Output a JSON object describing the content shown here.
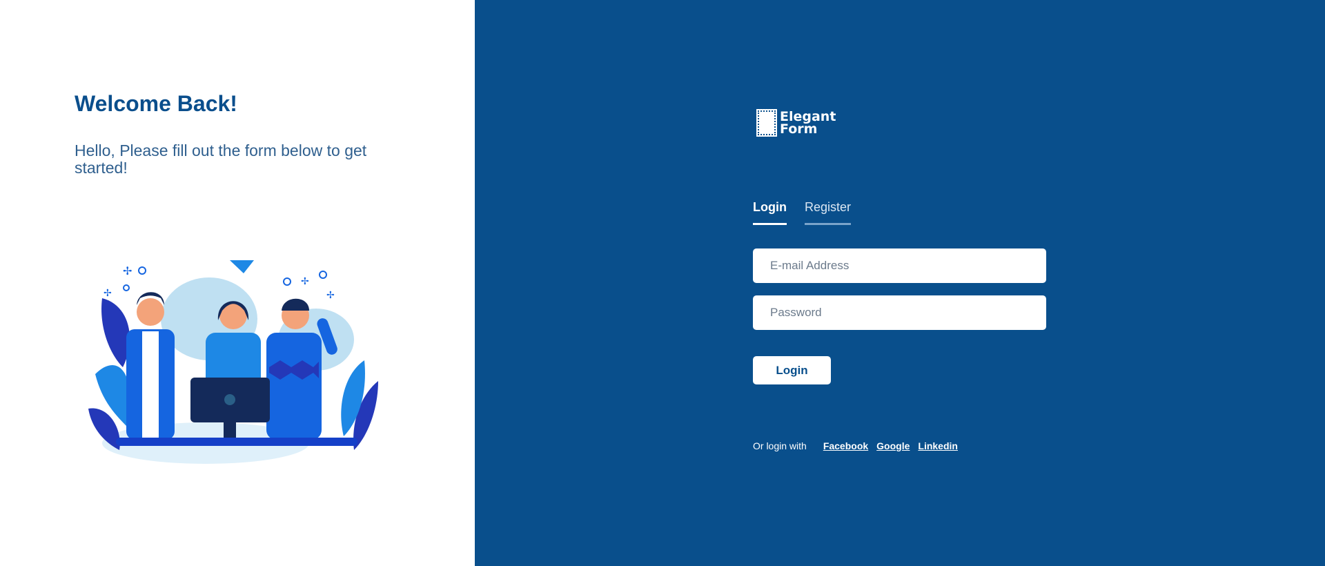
{
  "left": {
    "title": "Welcome Back!",
    "subtitle": "Hello, Please fill out the form below to get started!"
  },
  "logo": {
    "line1": "Elegant",
    "line2": "Form"
  },
  "tabs": [
    {
      "label": "Login",
      "active": true
    },
    {
      "label": "Register",
      "active": false
    }
  ],
  "form": {
    "email_placeholder": "E-mail Address",
    "password_placeholder": "Password",
    "submit_label": "Login"
  },
  "social": {
    "prefix": "Or login with",
    "links": [
      "Facebook",
      "Google",
      "Linkedin"
    ]
  },
  "colors": {
    "brand_blue": "#094f8c",
    "title_blue": "#0a4e8c",
    "illustration_blue": "#1565e0",
    "illustration_light": "#bfe0f2"
  },
  "illustration": "three-people-with-laptop"
}
